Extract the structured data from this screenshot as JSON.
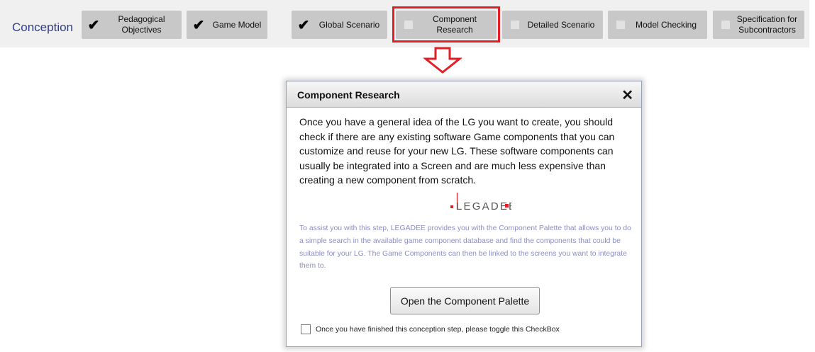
{
  "header": {
    "section_label": "Conception",
    "steps": [
      {
        "label": "Pedagogical\nObjectives",
        "done": true
      },
      {
        "label": "Game Model",
        "done": true
      },
      {
        "label": "Global Scenario",
        "done": true
      },
      {
        "label": "Component\nResearch",
        "done": false,
        "active": true
      },
      {
        "label": "Detailed Scenario",
        "done": false
      },
      {
        "label": "Model Checking",
        "done": false
      },
      {
        "label": "Specification for\nSubcontractors",
        "done": false
      }
    ],
    "check_glyph": "✔",
    "highlight_color": "#e21f26"
  },
  "dialog": {
    "title": "Component Research",
    "close_glyph": "✕",
    "intro_text": "Once you have a general idea of the LG you want to create, you should check if there are any existing software Game components that you can customize and reuse for your new LG. These software components can usually be integrated into a Screen and are much less expensive than creating a new component from scratch.",
    "logo_text": "LEGADEE",
    "assist_text": "To assist you with this step, LEGADEE provides you with the Component Palette that allows you to do a simple search in the available game component database and find the components that could be suitable for your LG. The Game Components can then be linked to the screens you want to integrate them to.",
    "open_button": "Open the Component Palette",
    "checkbox_label": "Once you have finished this conception step, please toggle this CheckBox"
  },
  "colors": {
    "accent_red": "#e21f26",
    "section_label_blue": "#2e3d8c",
    "assist_text": "#8a8ec2"
  }
}
